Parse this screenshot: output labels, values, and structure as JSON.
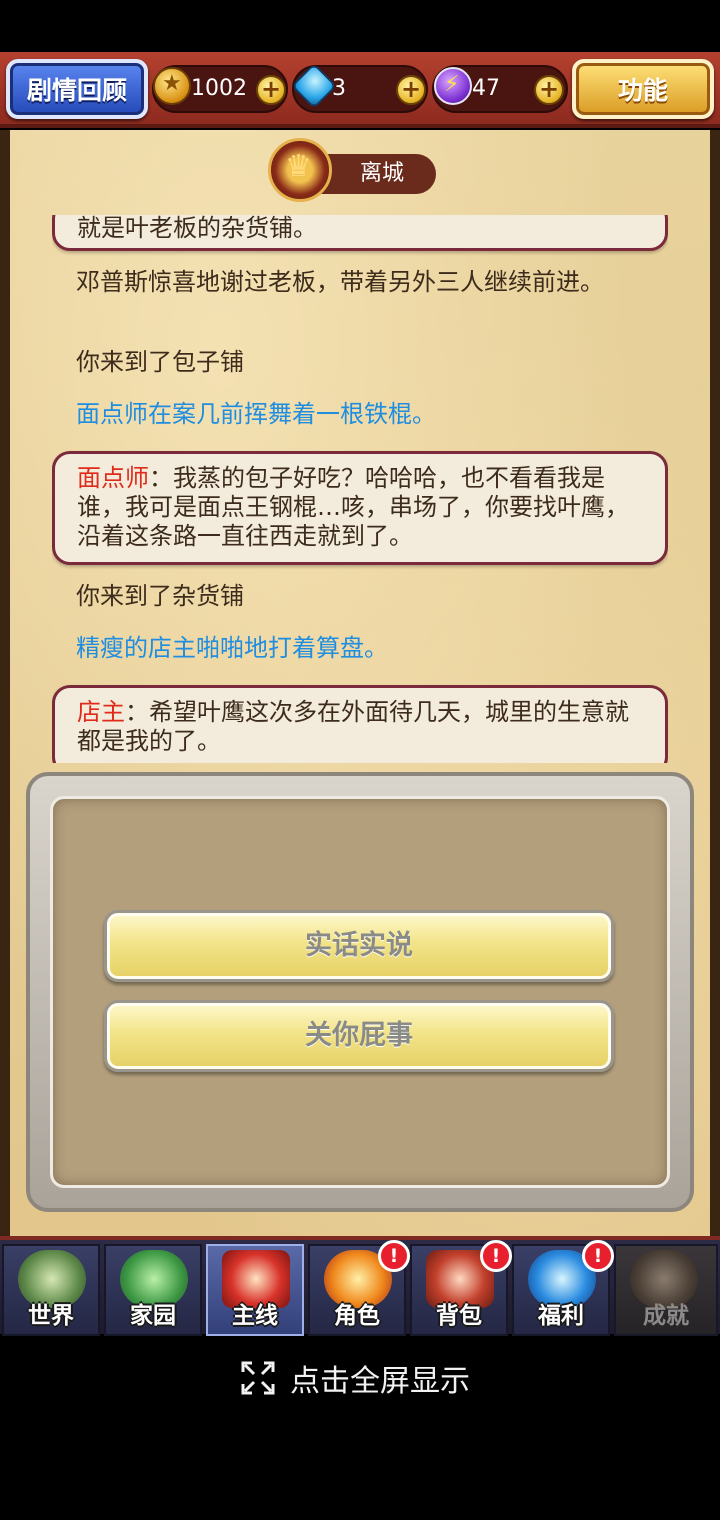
{
  "header": {
    "review_label": "剧情回顾",
    "function_label": "功能",
    "resources": [
      {
        "name": "coin",
        "value": "1002"
      },
      {
        "name": "diamond",
        "value": "3"
      },
      {
        "name": "energy",
        "value": "47"
      }
    ]
  },
  "location": {
    "name": "离城"
  },
  "story": [
    {
      "type": "bubble",
      "speaker": "",
      "text": "就是叶老板的杂货铺。"
    },
    {
      "type": "narration",
      "text": "邓普斯惊喜地谢过老板，带着另外三人继续前进。"
    },
    {
      "type": "narration",
      "text": "你来到了包子铺"
    },
    {
      "type": "action",
      "text": "面点师在案几前挥舞着一根铁棍。"
    },
    {
      "type": "bubble",
      "speaker": "面点师",
      "text": "：我蒸的包子好吃？哈哈哈，也不看看我是谁，我可是面点王钢棍…咳，串场了，你要找叶鹰，沿着这条路一直往西走就到了。"
    },
    {
      "type": "narration",
      "text": "你来到了杂货铺"
    },
    {
      "type": "action",
      "text": "精瘦的店主啪啪地打着算盘。"
    },
    {
      "type": "bubble",
      "speaker": "店主",
      "text": "：希望叶鹰这次多在外面待几天，城里的生意就都是我的了。"
    }
  ],
  "choices": [
    {
      "label": "实话实说"
    },
    {
      "label": "关你屁事"
    }
  ],
  "nav": [
    {
      "label": "世界",
      "active": false,
      "alert": false,
      "locked": false
    },
    {
      "label": "家园",
      "active": false,
      "alert": false,
      "locked": false
    },
    {
      "label": "主线",
      "active": true,
      "alert": false,
      "locked": false
    },
    {
      "label": "角色",
      "active": false,
      "alert": true,
      "locked": false
    },
    {
      "label": "背包",
      "active": false,
      "alert": true,
      "locked": false
    },
    {
      "label": "福利",
      "active": false,
      "alert": true,
      "locked": false
    },
    {
      "label": "成就",
      "active": false,
      "alert": false,
      "locked": true
    }
  ],
  "alert_mark": "!",
  "fullscreen_hint": "点击全屏显示",
  "colors": {
    "speaker": "#e02a1a",
    "action_text": "#1f8de0",
    "header_bar": "#b4412f"
  }
}
